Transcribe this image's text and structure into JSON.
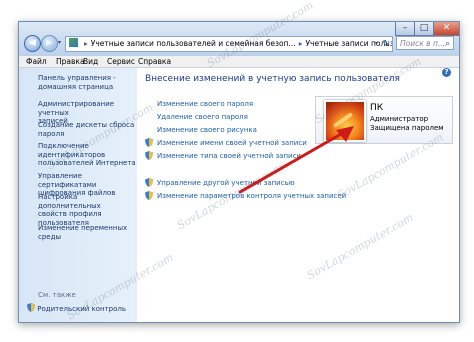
{
  "window": {
    "minimize_glyph": "–",
    "maximize_glyph": "□",
    "close_glyph": "✕"
  },
  "nav": {
    "back_glyph": "◀",
    "forward_glyph": "▶",
    "recent_glyph": "▾"
  },
  "address": {
    "separator": "▸",
    "crumbs": [
      "Учетные записи пользователей и семейная безоп...",
      "Учетные записи пользователей"
    ],
    "dropdown_glyph": "▾",
    "refresh_glyph": "↻"
  },
  "search": {
    "placeholder": "Поиск в п...",
    "icon_glyph": "⌕"
  },
  "menu": {
    "file": "Файл",
    "edit": "Правка",
    "view": "Вид",
    "service": "Сервис",
    "help": "Справка"
  },
  "sidebar": {
    "home": [
      "Панель управления -",
      "домашняя страница"
    ],
    "links": [
      [
        "Администрирование учетных",
        "записей"
      ],
      [
        "Создание дискеты сброса",
        "пароля"
      ],
      [
        "Подключение",
        "идентификаторов",
        "пользователей Интернета"
      ],
      [
        "Управление сертификатами",
        "шифрования файлов"
      ],
      [
        "Настройка дополнительных",
        "свойств профиля",
        "пользователя"
      ],
      [
        "Изменение переменных",
        "среды"
      ]
    ],
    "see_also": "См. также",
    "parental": "Родительский контроль"
  },
  "main": {
    "title": "Внесение изменений в учетную запись пользователя",
    "help_glyph": "?",
    "tasks": [
      "Изменение своего пароля",
      "Удаление своего пароля",
      "Изменение своего рисунка",
      "Изменение имени своей учетной записи",
      "Изменение типа своей учетной записи",
      "Управление другой учетной записью",
      "Изменение параметров контроля учетных записей"
    ]
  },
  "account": {
    "name": "ПК",
    "role": "Администратор",
    "status": "Защищена паролем"
  },
  "watermark": "SovLapcomputer.com",
  "colors": {
    "link": "#1e5ea8",
    "title": "#1e3a8c",
    "arrow": "#d01a1a"
  }
}
